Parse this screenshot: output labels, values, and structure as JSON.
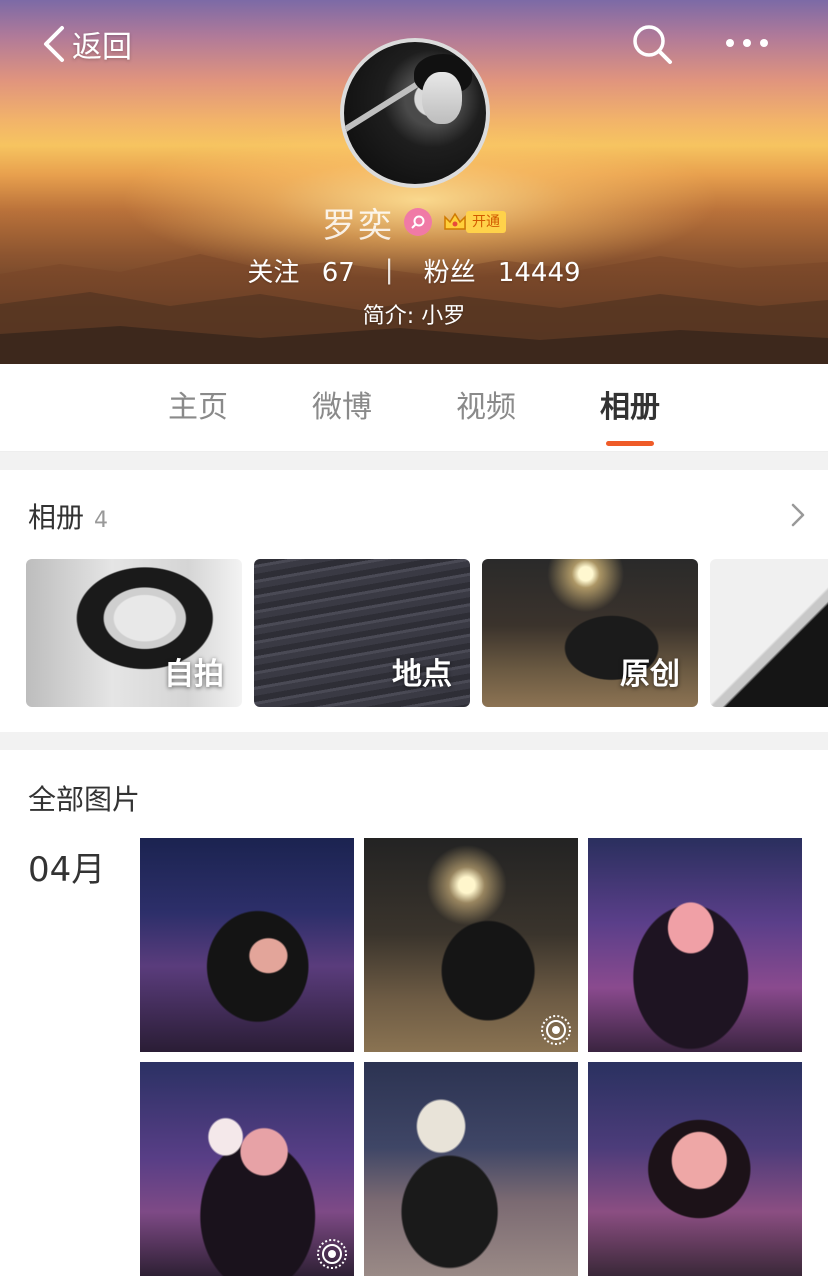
{
  "header": {
    "back_label": "返回",
    "name": "罗奕",
    "vip_label": "开通",
    "following_label": "关注",
    "following_count": "67",
    "separator": "|",
    "followers_label": "粉丝",
    "followers_count": "14449",
    "bio": "简介: 小罗"
  },
  "tabs": [
    {
      "label": "主页",
      "active": false
    },
    {
      "label": "微博",
      "active": false
    },
    {
      "label": "视频",
      "active": false
    },
    {
      "label": "相册",
      "active": true
    }
  ],
  "albums": {
    "title": "相册",
    "count": "4",
    "items": [
      {
        "label": "自拍"
      },
      {
        "label": "地点"
      },
      {
        "label": "原创"
      },
      {
        "label": ""
      }
    ]
  },
  "photos": {
    "title": "全部图片",
    "month": "04月",
    "items": [
      {
        "live": false
      },
      {
        "live": true
      },
      {
        "live": false
      },
      {
        "live": true
      },
      {
        "live": false
      },
      {
        "live": false
      }
    ]
  },
  "colors": {
    "accent": "#ef5b28",
    "gender_badge": "#f07aa6",
    "vip_gold": "#ffd24a"
  },
  "icons": [
    "chevron-left-icon",
    "search-icon",
    "more-icon",
    "female-icon",
    "crown-icon",
    "chevron-right-icon",
    "live-photo-icon"
  ]
}
